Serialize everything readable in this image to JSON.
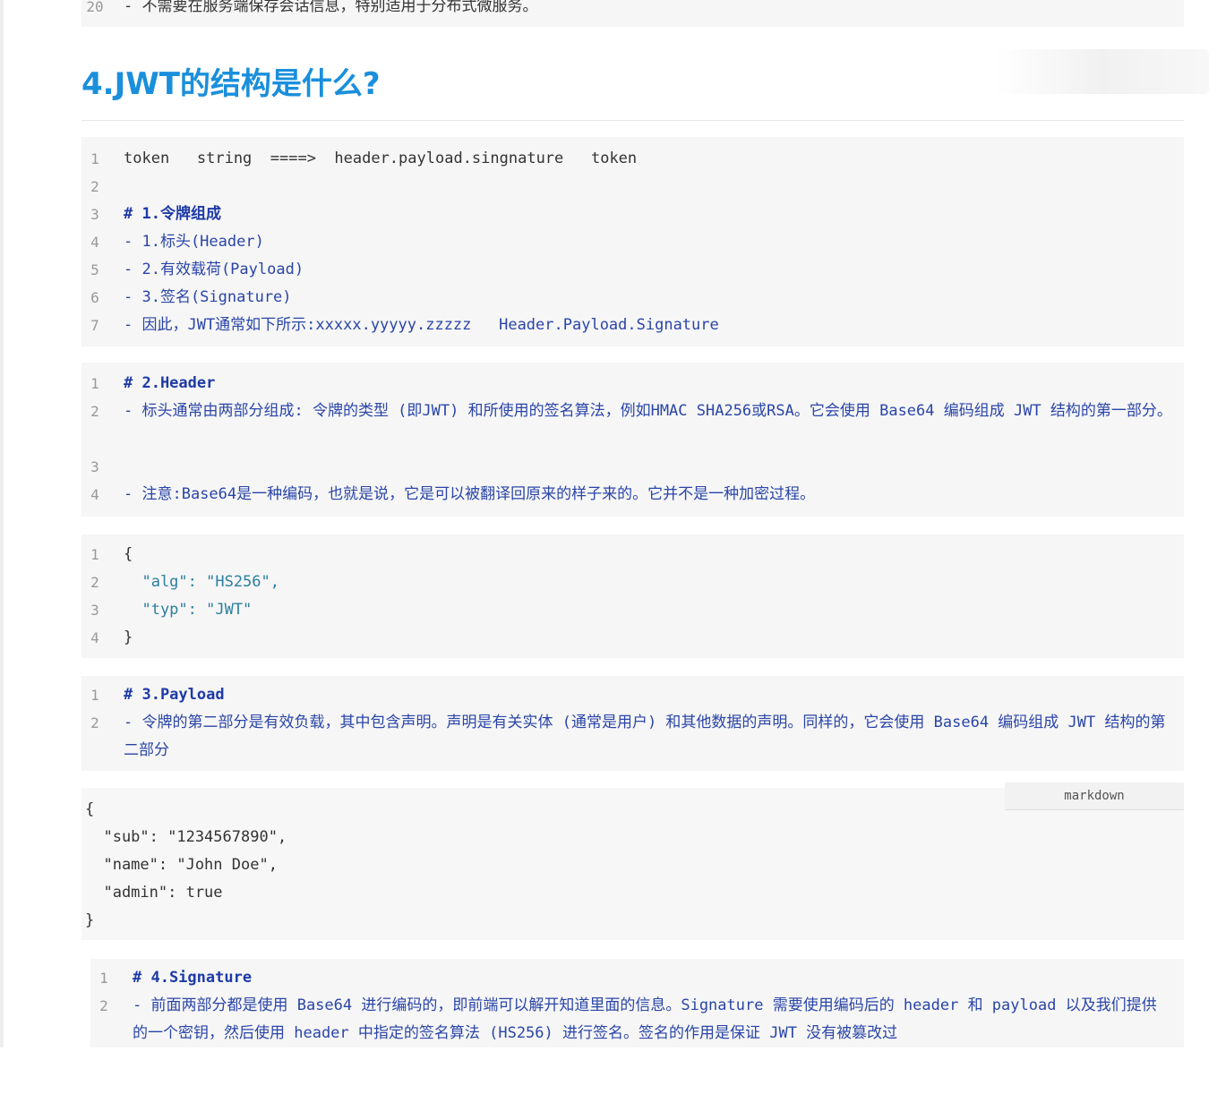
{
  "top_block": {
    "lines": [
      {
        "num": "20",
        "text": "- 不需要在服务端保存会话信息，特别适用于分布式微服务。"
      }
    ]
  },
  "section_heading": "4.JWT的结构是什么?",
  "block1": {
    "lines": [
      {
        "num": "1",
        "text": "token   string  ====>  header.payload.singnature   token"
      },
      {
        "num": "2",
        "text": ""
      },
      {
        "num": "3",
        "text": "# 1.令牌组成"
      },
      {
        "num": "4",
        "text": "- 1.标头(Header)"
      },
      {
        "num": "5",
        "text": "- 2.有效载荷(Payload)"
      },
      {
        "num": "6",
        "text": "- 3.签名(Signature)"
      },
      {
        "num": "7",
        "text": "- 因此，JWT通常如下所示:xxxxx.yyyyy.zzzzz   Header.Payload.Signature"
      }
    ]
  },
  "block2": {
    "lines": [
      {
        "num": "1",
        "text": "# 2.Header"
      },
      {
        "num": "2",
        "text": "- 标头通常由两部分组成: 令牌的类型 (即JWT) 和所使用的签名算法，例如HMAC SHA256或RSA。它会使用 Base64 编码组成 JWT 结构的第一部分。"
      },
      {
        "num": "3",
        "text": ""
      },
      {
        "num": "4",
        "text": "- 注意:Base64是一种编码，也就是说，它是可以被翻译回原来的样子来的。它并不是一种加密过程。"
      }
    ]
  },
  "block3": {
    "lines": [
      {
        "num": "1",
        "text": "{"
      },
      {
        "num": "2",
        "text": "  \"alg\": \"HS256\","
      },
      {
        "num": "3",
        "text": "  \"typ\": \"JWT\""
      },
      {
        "num": "4",
        "text": "}"
      }
    ]
  },
  "block4": {
    "lines": [
      {
        "num": "1",
        "text": "# 3.Payload"
      },
      {
        "num": "2",
        "text": "- 令牌的第二部分是有效负载，其中包含声明。声明是有关实体 (通常是用户) 和其他数据的声明。同样的，它会使用 Base64 编码组成 JWT 结构的第二部分"
      }
    ]
  },
  "block5": {
    "lang": "markdown",
    "lines": [
      "{",
      "  \"sub\": \"1234567890\",",
      "  \"name\": \"John Doe\",",
      "  \"admin\": true",
      "}"
    ]
  },
  "block6": {
    "lines": [
      {
        "num": "1",
        "text": "# 4.Signature"
      },
      {
        "num": "2",
        "text": "- 前面两部分都是使用 Base64 进行编码的，即前端可以解开知道里面的信息。Signature 需要使用编码后的 header 和 payload 以及我们提供的一个密钥，然后使用 header 中指定的签名算法 (HS256) 进行签名。签名的作用是保证 JWT 没有被篡改过"
      }
    ]
  },
  "colors": {
    "heading": "#1a8fdc",
    "markdown_heading": "#1e3aa8",
    "code_background": "#f6f6f6"
  }
}
